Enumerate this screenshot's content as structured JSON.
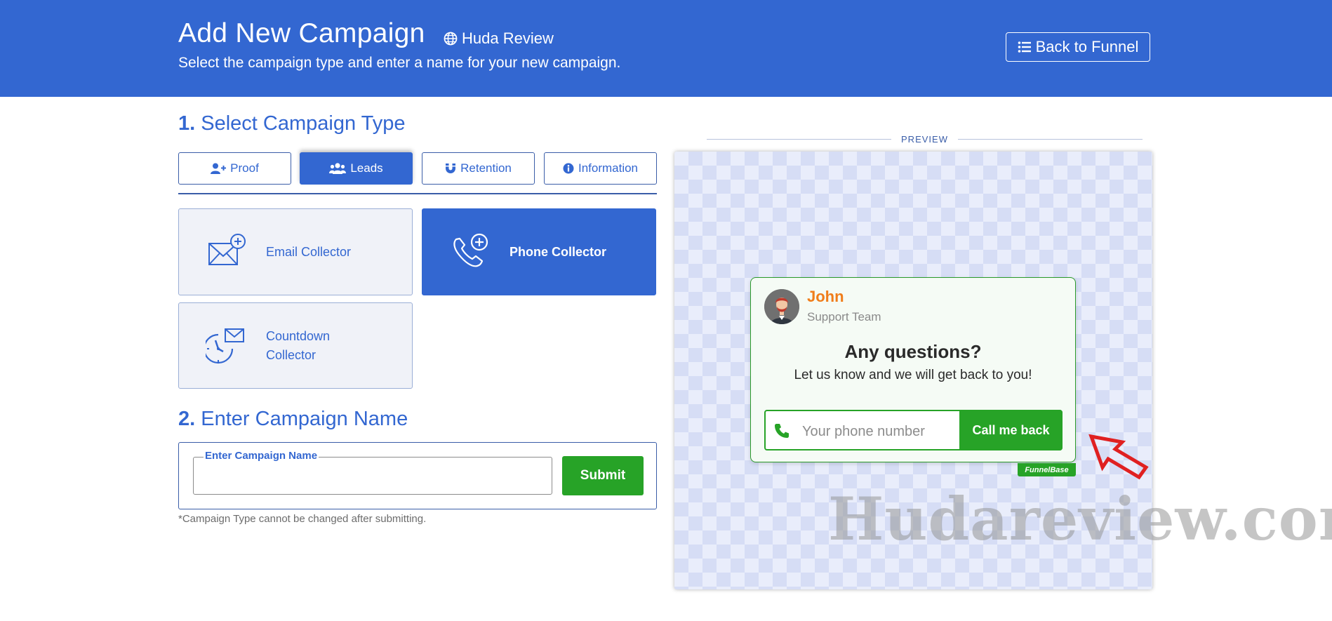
{
  "header": {
    "title": "Add New Campaign",
    "site_name": "Huda Review",
    "subtitle": "Select the campaign type and enter a name for your new campaign.",
    "back_button": "Back to Funnel"
  },
  "step1": {
    "number": "1.",
    "title": "Select Campaign Type",
    "tabs": [
      {
        "label": "Proof",
        "icon": "user-plus-icon",
        "active": false
      },
      {
        "label": "Leads",
        "icon": "users-icon",
        "active": true
      },
      {
        "label": "Retention",
        "icon": "magnet-icon",
        "active": false
      },
      {
        "label": "Information",
        "icon": "info-circle-icon",
        "active": false
      }
    ],
    "types": [
      {
        "label": "Email Collector",
        "icon": "envelope-plus-icon",
        "active": false
      },
      {
        "label": "Phone Collector",
        "icon": "phone-plus-icon",
        "active": true
      },
      {
        "label": "Countdown Collector",
        "icon": "clock-envelope-icon",
        "active": false
      }
    ]
  },
  "step2": {
    "number": "2.",
    "title": "Enter Campaign Name",
    "field_label": "Enter Campaign Name",
    "field_value": "",
    "submit": "Submit",
    "note": "*Campaign Type cannot be changed after submitting."
  },
  "preview": {
    "label": "PREVIEW",
    "agent_name": "John",
    "agent_role": "Support Team",
    "title": "Any questions?",
    "text": "Let us know and we will get back to you!",
    "phone_placeholder": "Your phone number",
    "call_button": "Call me back",
    "badge": "FunnelBase"
  },
  "watermark": "Hudareview.com",
  "colors": {
    "primary": "#3367d1",
    "success": "#27a327",
    "agent_name": "#f07d1a",
    "arrow": "#e02020"
  }
}
